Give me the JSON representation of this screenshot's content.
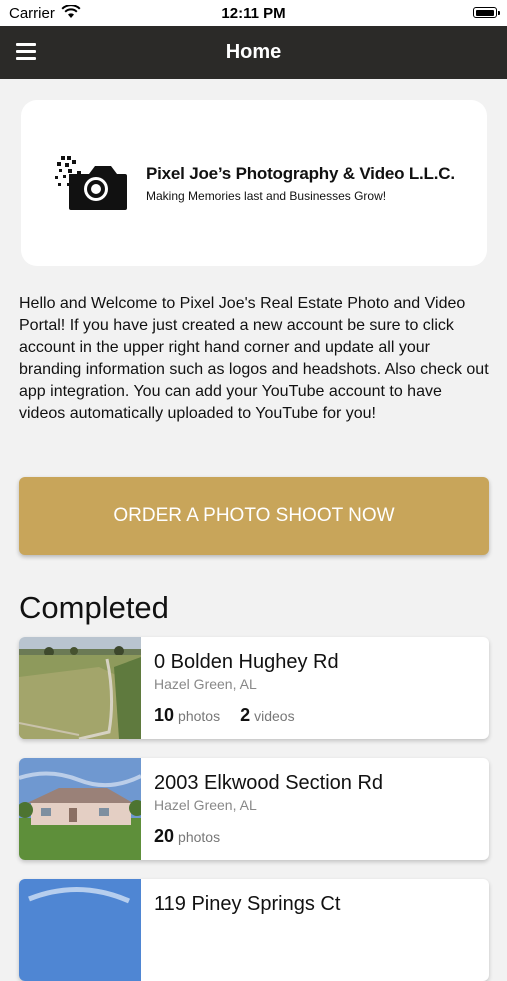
{
  "status_bar": {
    "carrier": "Carrier",
    "time": "12:11 PM",
    "battery_level": 0.95
  },
  "nav": {
    "title": "Home",
    "menu_icon": "hamburger-menu-icon"
  },
  "logo": {
    "icon": "camera-icon",
    "company_name": "Pixel Joe’s Photography & Video L.L.C.",
    "tagline": "Making Memories last and Businesses Grow!"
  },
  "intro_text": "Hello and Welcome to Pixel Joe's Real Estate Photo and Video Portal! If you have just created a new account be sure to click account in the upper right hand corner and update all your branding information such as logos and headshots. Also check out app integration. You can add your YouTube account to have videos automatically uploaded to YouTube for you!",
  "order_button": {
    "label": "ORDER A PHOTO SHOOT NOW",
    "color": "#c8a55a"
  },
  "completed": {
    "heading": "Completed",
    "items": [
      {
        "address": "0 Bolden Hughey Rd",
        "city": "Hazel Green, AL",
        "photos": "10",
        "photos_label": "photos",
        "videos": "2",
        "videos_label": "videos"
      },
      {
        "address": "2003 Elkwood Section Rd",
        "city": "Hazel Green, AL",
        "photos": "20",
        "photos_label": "photos"
      },
      {
        "address": "119 Piney Springs Ct"
      }
    ]
  }
}
